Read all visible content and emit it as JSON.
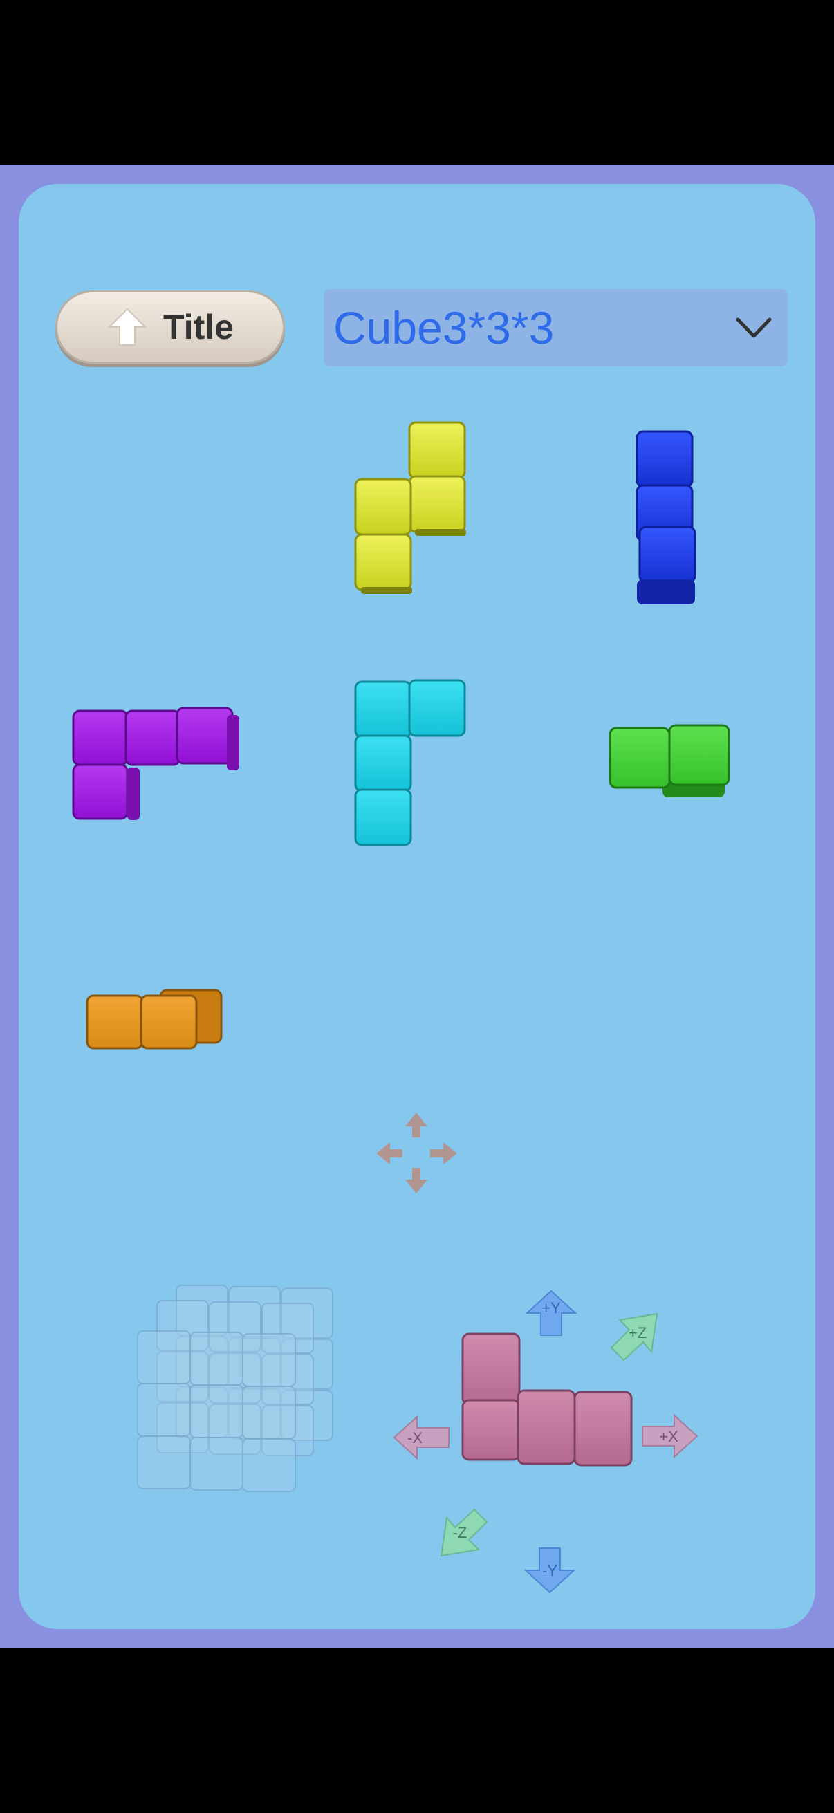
{
  "header": {
    "title_button_label": "Title",
    "puzzle_select": {
      "selected": "Cube3*3*3"
    }
  },
  "pieces": [
    {
      "name": "yellow-piece",
      "color": "#d8e12e"
    },
    {
      "name": "blue-piece",
      "color": "#1f3fe8"
    },
    {
      "name": "purple-piece",
      "color": "#a016e0"
    },
    {
      "name": "cyan-piece",
      "color": "#1dcde3"
    },
    {
      "name": "green-piece",
      "color": "#44cf3a"
    },
    {
      "name": "orange-piece",
      "color": "#e69720"
    },
    {
      "name": "active-piece",
      "color": "#c27a9d"
    }
  ],
  "controls": {
    "plus_y": "+Y",
    "minus_y": "-Y",
    "plus_x": "+X",
    "minus_x": "-X",
    "plus_z": "+Z",
    "minus_z": "-Z"
  },
  "icons": {
    "title_button": "up-arrow-icon",
    "dropdown": "chevron-down-icon",
    "pan": "move-arrows-icon"
  }
}
